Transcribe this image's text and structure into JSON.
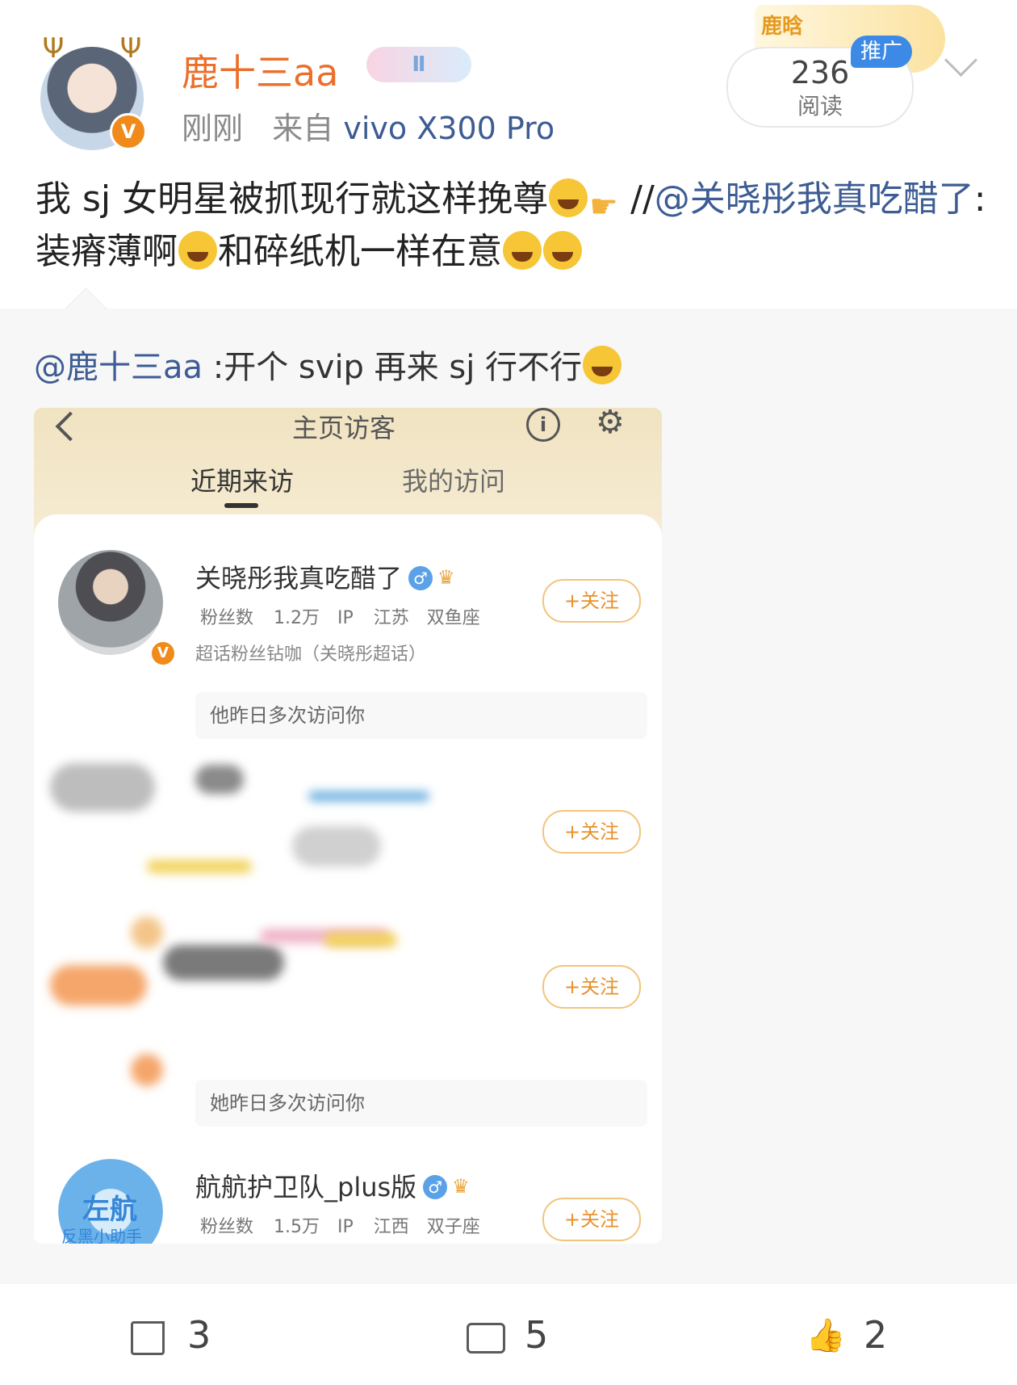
{
  "post": {
    "username": "鹿十三aa",
    "level_badge": "Ⅱ",
    "time": "刚刚",
    "source_prefix": "来自",
    "device": "vivo X300 Pro",
    "promo_stamp": "鹿晗",
    "reads_count": "236",
    "reads_label": "阅读",
    "ad_tag": "推广",
    "text_part1": "我 sj 女明星被抓现行就这样挽尊",
    "text_part2": "//",
    "mention": "@关晓彤我真吃醋了",
    "text_part3": ":装瘠薄啊",
    "text_part4": "和碎纸机一样在意",
    "icons": [
      "rofl-emoji",
      "pointing-hand-emoji",
      "laugh-cry-emoji"
    ]
  },
  "repost": {
    "mention": "@鹿十三aa",
    "text": " :开个 svip 再来 sj 行不行"
  },
  "screenshot": {
    "title": "主页访客",
    "info_icon": "i",
    "tabs": [
      "近期来访",
      "我的访问"
    ],
    "users": [
      {
        "name": "关晓彤我真吃醋了",
        "fans": "粉丝数 1.2万",
        "ip": "IP 江苏",
        "sign": "双鱼座",
        "super": "超话粉丝钻咖（关晓彤超话）",
        "follow": "+关注",
        "note": "他昨日多次访问你"
      },
      {
        "follow": "+关注"
      },
      {
        "follow": "+关注",
        "note": "她昨日多次访问你"
      },
      {
        "name": "航航护卫队_plus版",
        "avatar_text": "左航",
        "avatar_sub": "反黑小助手",
        "fans": "粉丝数 1.5万",
        "ip": "IP 江西",
        "sign": "双子座",
        "follow": "+关注"
      }
    ]
  },
  "footer": {
    "share_count": "3",
    "comment_count": "5",
    "like_count": "2"
  }
}
